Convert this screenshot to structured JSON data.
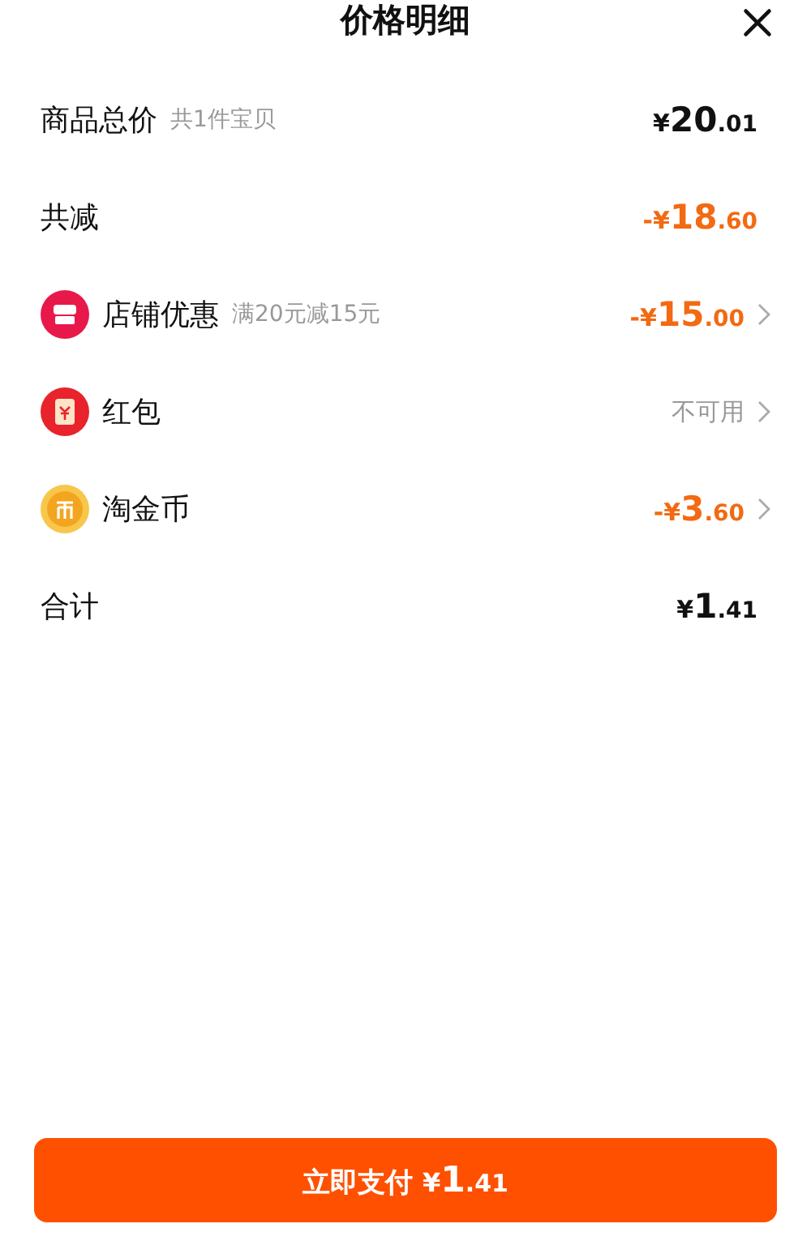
{
  "title": "价格明细",
  "rows": [
    {
      "label": "商品总价",
      "note": "共1件宝贝",
      "kind": "plain",
      "amount": {
        "kind": "plain",
        "sign": "¥",
        "main": "20",
        "fraction": ".01"
      },
      "chevron": false
    },
    {
      "label": "共减",
      "kind": "plain",
      "amount": {
        "kind": "discount",
        "sign": "-¥",
        "main": "18",
        "fraction": ".60"
      },
      "chevron": false
    },
    {
      "label": "店铺优惠",
      "note": "满20元减15元",
      "kind": "shop",
      "amount": {
        "kind": "discount",
        "sign": "-¥",
        "main": "15",
        "fraction": ".00"
      },
      "chevron": true
    },
    {
      "label": "红包",
      "kind": "envelope",
      "status": "不可用",
      "chevron": true
    },
    {
      "label": "淘金币",
      "kind": "coin",
      "amount": {
        "kind": "discount",
        "sign": "-¥",
        "main": "3",
        "fraction": ".60"
      },
      "chevron": true
    },
    {
      "label": "合计",
      "kind": "plain",
      "amount": {
        "kind": "plain",
        "sign": "¥",
        "main": "1",
        "fraction": ".41"
      },
      "chevron": false
    }
  ],
  "pay_button": {
    "label": "立即支付",
    "sign": "¥",
    "main": "1",
    "fraction": ".41"
  }
}
